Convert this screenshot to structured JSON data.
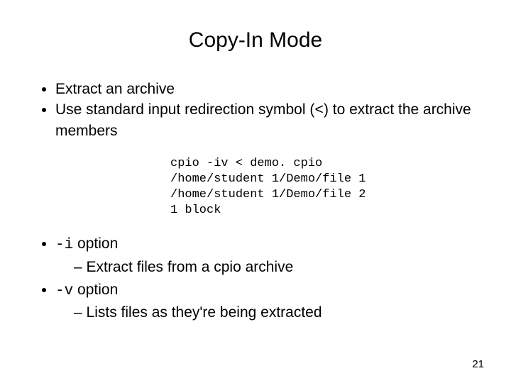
{
  "title": "Copy-In Mode",
  "bullets": {
    "b1": "Extract an archive",
    "b2_pre": "Use standard input redirection symbol (",
    "b2_sym": "<",
    "b2_post": ") to extract the archive members"
  },
  "code": {
    "l1": "cpio -iv < demo. cpio",
    "l2": "/home/student 1/Demo/file 1",
    "l3": "/home/student 1/Demo/file 2",
    "l4": "1 block"
  },
  "opts": {
    "i_flag": "-i",
    "i_word": " option",
    "i_desc": "Extract files from a cpio archive",
    "v_flag": "-v",
    "v_word": " option",
    "v_desc": "Lists files as they're being extracted"
  },
  "page": "21"
}
